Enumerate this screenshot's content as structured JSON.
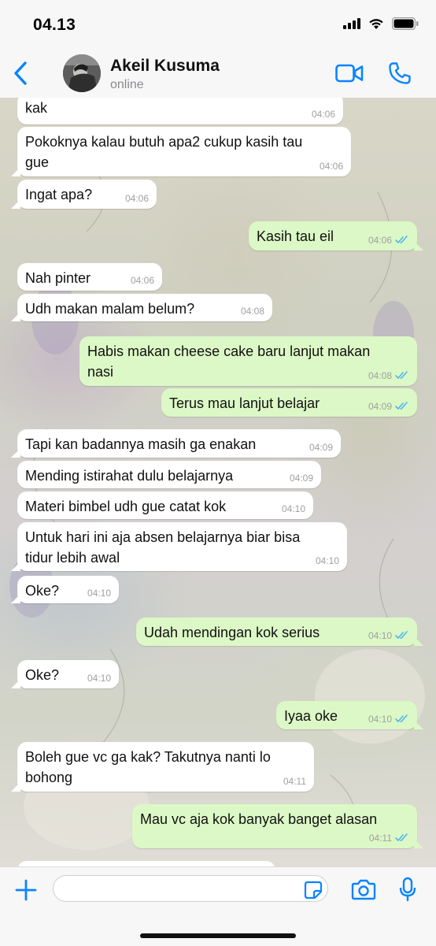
{
  "status_bar": {
    "time": "04.13"
  },
  "header": {
    "contact_name": "Akeil Kusuma",
    "status": "online"
  },
  "colors": {
    "accent": "#0a84ff",
    "incoming_bubble": "#ffffff",
    "outgoing_bubble": "#dcf8c6",
    "read_tick": "#4fb6ec"
  },
  "icons": [
    "back-chevron-icon",
    "video-call-icon",
    "phone-call-icon",
    "plus-icon",
    "sticker-icon",
    "camera-icon",
    "microphone-icon"
  ],
  "messages": [
    {
      "dir": "in",
      "lines": [
        "kak"
      ],
      "time": "04:06"
    },
    {
      "dir": "in",
      "lines": [
        "Pokoknya kalau butuh apa2 cukup kasih tau",
        "gue"
      ],
      "time": "04:06"
    },
    {
      "dir": "in",
      "lines": [
        "Ingat apa?"
      ],
      "time": "04:06"
    },
    {
      "dir": "out",
      "lines": [
        "Kasih tau eil"
      ],
      "time": "04:06"
    },
    {
      "dir": "in",
      "lines": [
        "Nah pinter"
      ],
      "time": "04:06"
    },
    {
      "dir": "in",
      "lines": [
        "Udh makan malam belum?"
      ],
      "time": "04:08"
    },
    {
      "dir": "out",
      "lines": [
        "Habis makan cheese cake baru lanjut makan",
        "nasi"
      ],
      "time": "04:08"
    },
    {
      "dir": "out",
      "lines": [
        "Terus mau lanjut belajar"
      ],
      "time": "04:09"
    },
    {
      "dir": "in",
      "lines": [
        "Tapi kan badannya masih ga enakan"
      ],
      "time": "04:09"
    },
    {
      "dir": "in",
      "lines": [
        "Mending istirahat dulu belajarnya"
      ],
      "time": "04:09"
    },
    {
      "dir": "in",
      "lines": [
        "Materi bimbel udh gue catat kok"
      ],
      "time": "04:10"
    },
    {
      "dir": "in",
      "lines": [
        "Untuk hari ini aja absen belajarnya biar bisa",
        "tidur lebih awal"
      ],
      "time": "04:10"
    },
    {
      "dir": "in",
      "lines": [
        "Oke?"
      ],
      "time": "04:10"
    },
    {
      "dir": "out",
      "lines": [
        "Udah mendingan kok serius"
      ],
      "time": "04:10"
    },
    {
      "dir": "in",
      "lines": [
        "Oke?"
      ],
      "time": "04:10"
    },
    {
      "dir": "out",
      "lines": [
        "Iyaa oke"
      ],
      "time": "04:10"
    },
    {
      "dir": "in",
      "lines": [
        "Boleh gue vc ga kak? Takutnya nanti lo",
        "bohong"
      ],
      "time": "04:11"
    },
    {
      "dir": "out",
      "lines": [
        "Mau vc aja kok banyak banget alasan"
      ],
      "time": "04:11"
    }
  ],
  "composer": {
    "value": "",
    "placeholder": ""
  }
}
